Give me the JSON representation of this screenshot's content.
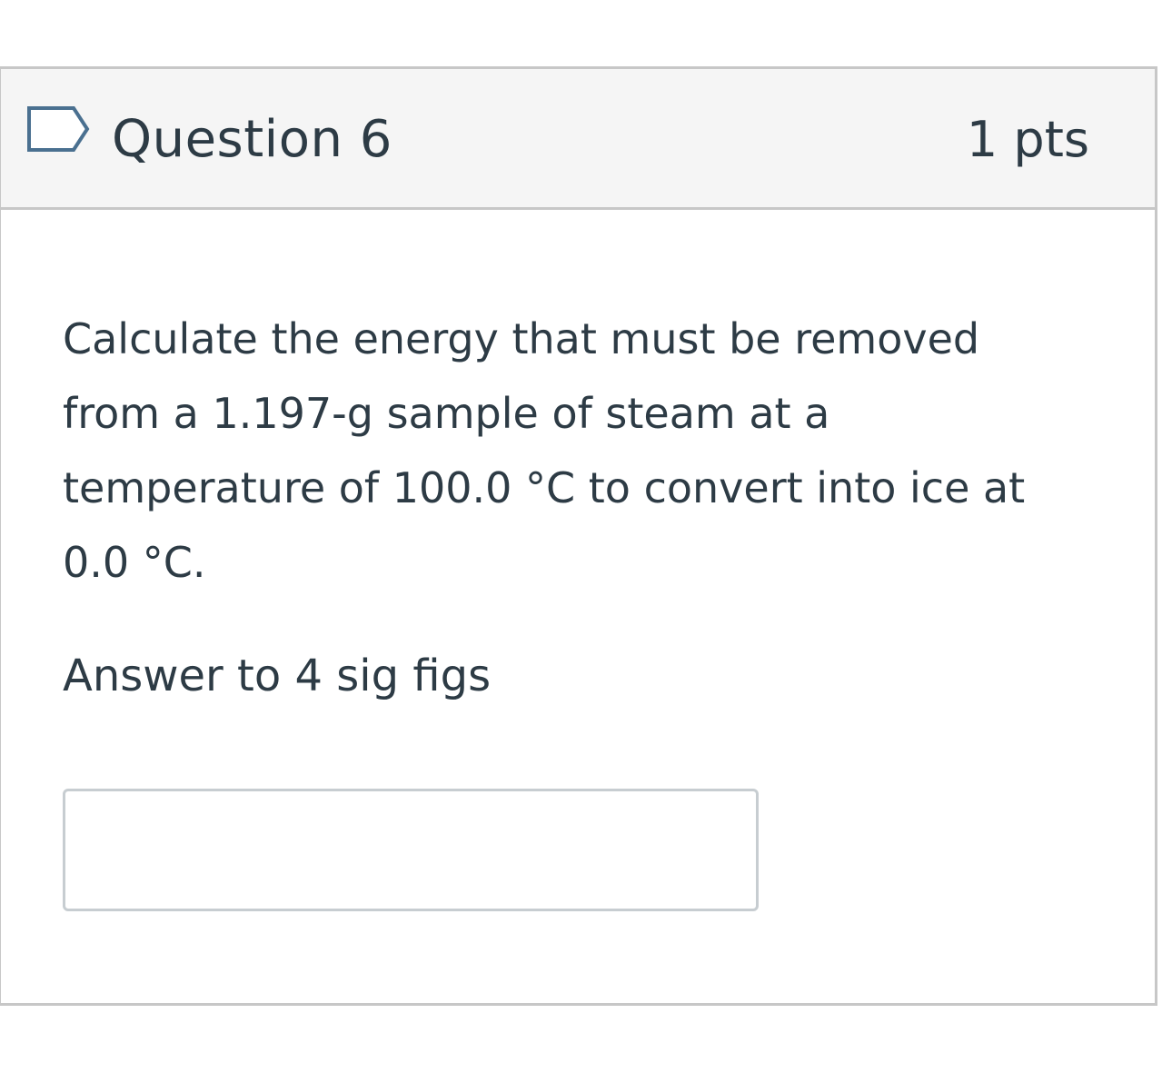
{
  "question": {
    "title": "Question 6",
    "points": "1 pts",
    "flag_icon": "bookmark-flag-icon",
    "text": "Calculate the energy that must be removed from a 1.197-g sample of steam at a temperature of 100.0 °C to convert into ice at 0.0 °C.",
    "instruction": "Answer to 4 sig figs",
    "answer_value": ""
  },
  "colors": {
    "header_background": "#f5f5f5",
    "border": "#c7c7c7",
    "text": "#2d3b45",
    "flag_icon": "#c7cdd1"
  }
}
